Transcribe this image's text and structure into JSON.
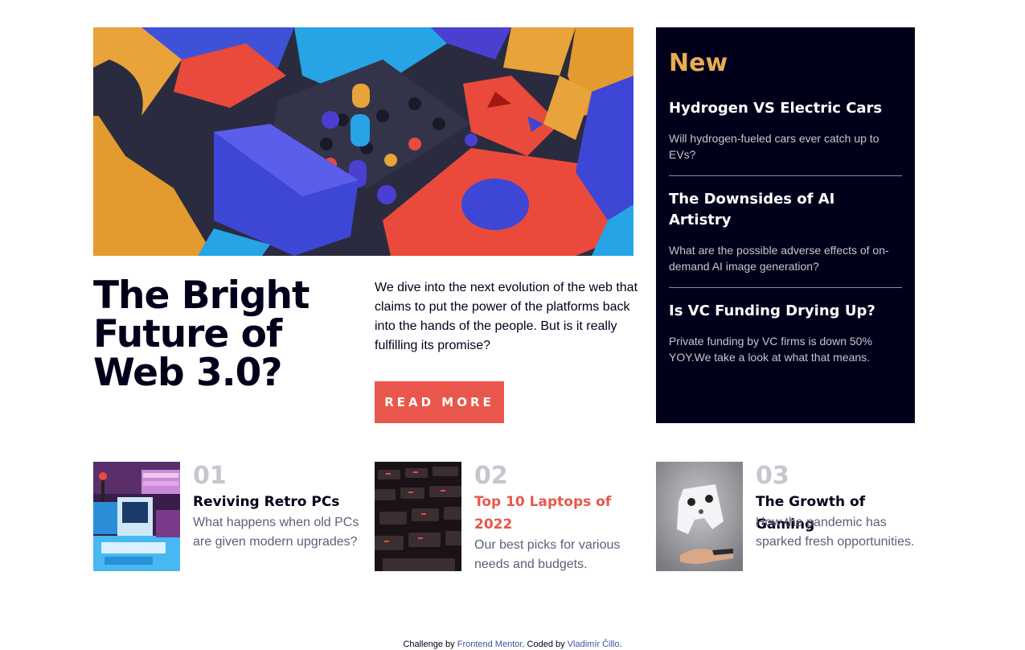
{
  "hero": {
    "image_alt": "Colorful 3D geometric blocks",
    "headline": "The Bright Future of Web 3.0?",
    "lead": "We dive into the next evolution of the web that claims to put the power of the platforms back into the hands of the people. But is it really fulfilling its promise?",
    "cta_label": "READ MORE"
  },
  "new_panel": {
    "title": "New",
    "items": [
      {
        "title": "Hydrogen VS Electric Cars",
        "text": "Will hydrogen-fueled cars ever catch up to EVs?"
      },
      {
        "title": "The Downsides of AI Artistry",
        "text": "What are the possible adverse effects of on-demand AI image generation?"
      },
      {
        "title": "Is VC Funding Drying Up?",
        "text": "Private funding by VC firms is down 50% YOY.We take a look at what that means."
      }
    ]
  },
  "cards": [
    {
      "num": "01",
      "title": "Reviving Retro PCs",
      "text": "What happens when old PCs are given modern upgrades?",
      "thumb": "retro-pc-image"
    },
    {
      "num": "02",
      "title": "Top 10 Laptops of 2022",
      "text": "Our best picks for various needs and budgets.",
      "thumb": "laptop-keyboard-image"
    },
    {
      "num": "03",
      "title": "The Growth of Gaming",
      "text": "How the pandemic has sparked fresh opportunities.",
      "thumb": "gamepad-image"
    }
  ],
  "footer": {
    "prefix": "Challenge by ",
    "link1": "Frontend Mentor",
    "middle": ". Coded by ",
    "link2": "Vladimír Čillo",
    "suffix": "."
  },
  "colors": {
    "accent": "#e9574c",
    "panel_bg": "#00001a",
    "panel_title": "#e9ab53",
    "muted": "#5d5f79",
    "number": "#c5c6ce"
  }
}
